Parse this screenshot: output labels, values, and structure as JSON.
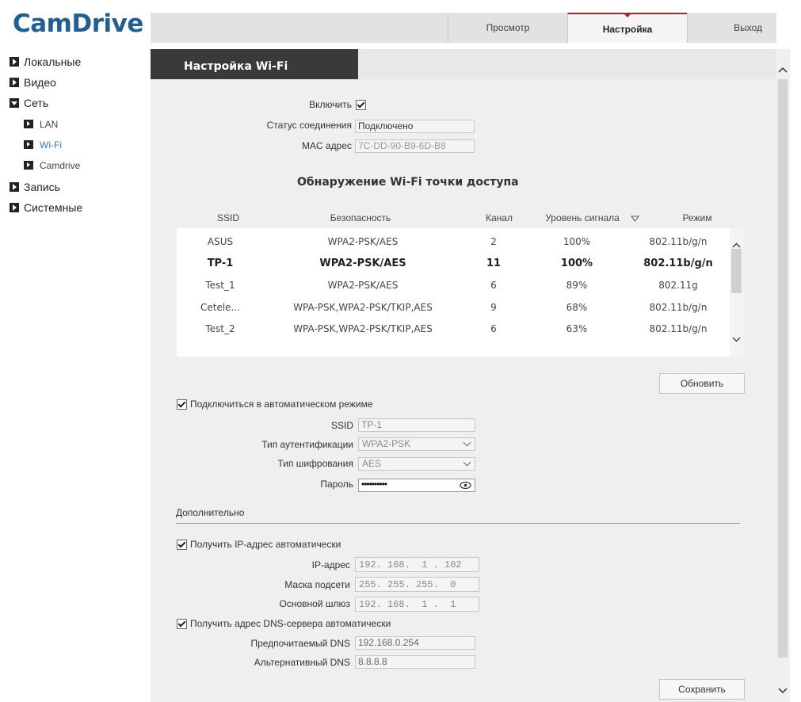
{
  "brand": {
    "logo": "CamDrive"
  },
  "tabs": [
    {
      "label": "Просмотр",
      "active": false
    },
    {
      "label": "Настройка",
      "active": true
    },
    {
      "label": "Выход",
      "active": false
    }
  ],
  "sidebar": {
    "items": [
      {
        "label": "Локальные"
      },
      {
        "label": "Видео"
      },
      {
        "label": "Сеть"
      },
      {
        "label": "LAN"
      },
      {
        "label": "Wi-Fi"
      },
      {
        "label": "Camdrive"
      },
      {
        "label": "Запись"
      },
      {
        "label": "Системные"
      }
    ]
  },
  "page": {
    "title": "Настройка Wi-Fi"
  },
  "status": {
    "enable_label": "Включить",
    "enable_checked": true,
    "connection_label": "Статус соединения",
    "connection_value": "Подключено",
    "mac_label": "MAC адрес",
    "mac_value": "7C-DD-90-B9-6D-B8"
  },
  "discovery": {
    "heading": "Обнаружение Wi-Fi точки доступа",
    "columns": [
      "SSID",
      "Безопасность",
      "Канал",
      "Уровень сигнала",
      "Режим"
    ],
    "rows": [
      {
        "ssid": "ASUS",
        "security": "WPA2-PSK/AES",
        "channel": "2",
        "signal": "100%",
        "mode": "802.11b/g/n",
        "selected": false
      },
      {
        "ssid": "TP-1",
        "security": "WPA2-PSK/AES",
        "channel": "11",
        "signal": "100%",
        "mode": "802.11b/g/n",
        "selected": true
      },
      {
        "ssid": "Test_1",
        "security": "WPA2-PSK/AES",
        "channel": "6",
        "signal": "89%",
        "mode": "802.11g",
        "selected": false
      },
      {
        "ssid": "Cetele...",
        "security": "WPA-PSK,WPA2-PSK/TKIP,AES",
        "channel": "9",
        "signal": "68%",
        "mode": "802.11b/g/n",
        "selected": false
      },
      {
        "ssid": "Test_2",
        "security": "WPA-PSK,WPA2-PSK/TKIP,AES",
        "channel": "6",
        "signal": "63%",
        "mode": "802.11b/g/n",
        "selected": false
      }
    ],
    "refresh_label": "Обновить"
  },
  "auto_connect": {
    "label": "Подключиться в автоматическом режиме",
    "checked": true,
    "ssid_label": "SSID",
    "ssid_value": "TP-1",
    "auth_label": "Тип аутентификации",
    "auth_value": "WPA2-PSK",
    "enc_label": "Тип шифрования",
    "enc_value": "AES",
    "password_label": "Пароль",
    "password_mask": "••••••••••"
  },
  "advanced": {
    "heading": "Дополнительно",
    "auto_ip_label": "Получить IP-адрес автоматически",
    "ip_label": "IP-адрес",
    "ip_value": "192. 168.  1 . 102",
    "mask_label": "Маска подсети",
    "mask_value": "255. 255. 255.  0",
    "gw_label": "Основной шлюз",
    "gw_value": "192. 168.  1 .  1",
    "auto_dns_label": "Получить адрес DNS-сервера автоматически",
    "dns1_label": "Предпочитаемый DNS",
    "dns1_value": "192.168.0.254",
    "dns2_label": "Альтернативный DNS",
    "dns2_value": "8.8.8.8"
  },
  "save_label": "Сохранить",
  "colors": {
    "brand": "#1f5f96",
    "accent": "#a52a2a",
    "selected_link": "#3a78c2"
  }
}
